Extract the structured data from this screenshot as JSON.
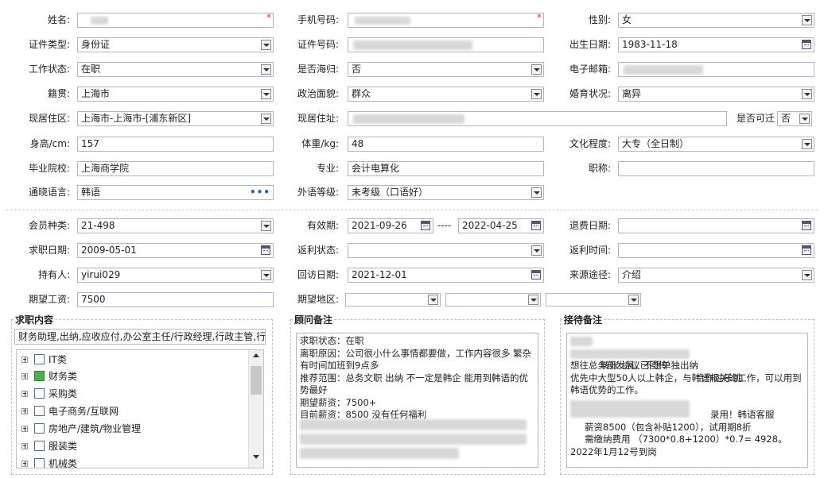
{
  "basic": {
    "name_label": "姓名:",
    "phone_label": "手机号码:",
    "gender_label": "性别:",
    "gender_value": "女",
    "idtype_label": "证件类型:",
    "idtype_value": "身份证",
    "idno_label": "证件号码:",
    "birth_label": "出生日期:",
    "birth_value": "1983-11-18",
    "workstatus_label": "工作状态:",
    "workstatus_value": "在职",
    "returnee_label": "是否海归:",
    "returnee_value": "否",
    "email_label": "电子邮箱:",
    "native_label": "籍贯:",
    "native_value": "上海市",
    "political_label": "政治面貌:",
    "political_value": "群众",
    "marital_label": "婚育状况:",
    "marital_value": "离异",
    "area_label": "现居住区:",
    "area_value": "上海市-上海市-[浦东新区]",
    "addr_label": "现居住址:",
    "relocate_label": "是否可迁",
    "relocate_value": "否",
    "height_label": "身高/cm:",
    "height_value": "157",
    "weight_label": "体重/kg:",
    "weight_value": "48",
    "edu_label": "文化程度:",
    "edu_value": "大专（全日制）",
    "school_label": "毕业院校:",
    "school_value": "上海商学院",
    "major_label": "专业:",
    "major_value": "会计电算化",
    "title_label": "职称:",
    "title_value": "",
    "lang_label": "通晓语言:",
    "lang_value": "韩语",
    "lang_more": "•••",
    "foreign_label": "外语等级:",
    "foreign_value": "未考级（口语好）",
    "required_mark": "*"
  },
  "member": {
    "type_label": "会员种类:",
    "type_value": "21-498",
    "valid_label": "有效期:",
    "valid_from": "2021-09-26",
    "valid_sep": "----",
    "valid_to": "2022-04-25",
    "refund_label": "退费日期:",
    "jobdate_label": "求职日期:",
    "jobdate_value": "2009-05-01",
    "rebate_status_label": "返利状态:",
    "rebate_time_label": "返利时间:",
    "holder_label": "持有人:",
    "holder_value": "yirui029",
    "visit_label": "回访日期:",
    "visit_value": "2021-12-01",
    "source_label": "来源途径:",
    "source_value": "介绍",
    "salary_label": "期望工资:",
    "salary_value": "7500",
    "region_label": "期望地区:"
  },
  "job": {
    "title": "求职内容",
    "summary": "财务助理,出纳,应收应付,办公室主任/行政经理,行政主管,行",
    "items": [
      {
        "label": "IT类",
        "checked": false
      },
      {
        "label": "财务类",
        "checked": true
      },
      {
        "label": "采购类",
        "checked": false
      },
      {
        "label": "电子商务/互联网",
        "checked": false
      },
      {
        "label": "房地产/建筑/物业管理",
        "checked": false
      },
      {
        "label": "服装类",
        "checked": false
      },
      {
        "label": "机械类",
        "checked": false
      }
    ]
  },
  "advisor": {
    "title": "顾问备注",
    "lines": [
      "求职状态：在职",
      "离职原因：公司很小什么事情都要做，工作内容很多 繁杂 有时间加班到9点多",
      "推荐范围：总务文职 出纳 不一定是韩企 能用到韩语的优势最好",
      "期望薪资：7500+",
      "目前薪资：8500 没有任何福利"
    ]
  },
  "reception": {
    "title": "接待备注",
    "line1": "转账 协议已回传",
    "line2": "合作过乐跳",
    "line3": "想往总务部发展，不想单独出纳",
    "line4": "优先中大型50人以上韩企，与韩语相关的工作，可以用到韩语优势的工作。",
    "line5": "录用！韩语客服",
    "line6": "薪资8500（包含补贴1200），试用期8折",
    "line7": "需缴纳费用 （7300*0.8+1200）*0.7= 4928。2022年1月12号到岗"
  }
}
